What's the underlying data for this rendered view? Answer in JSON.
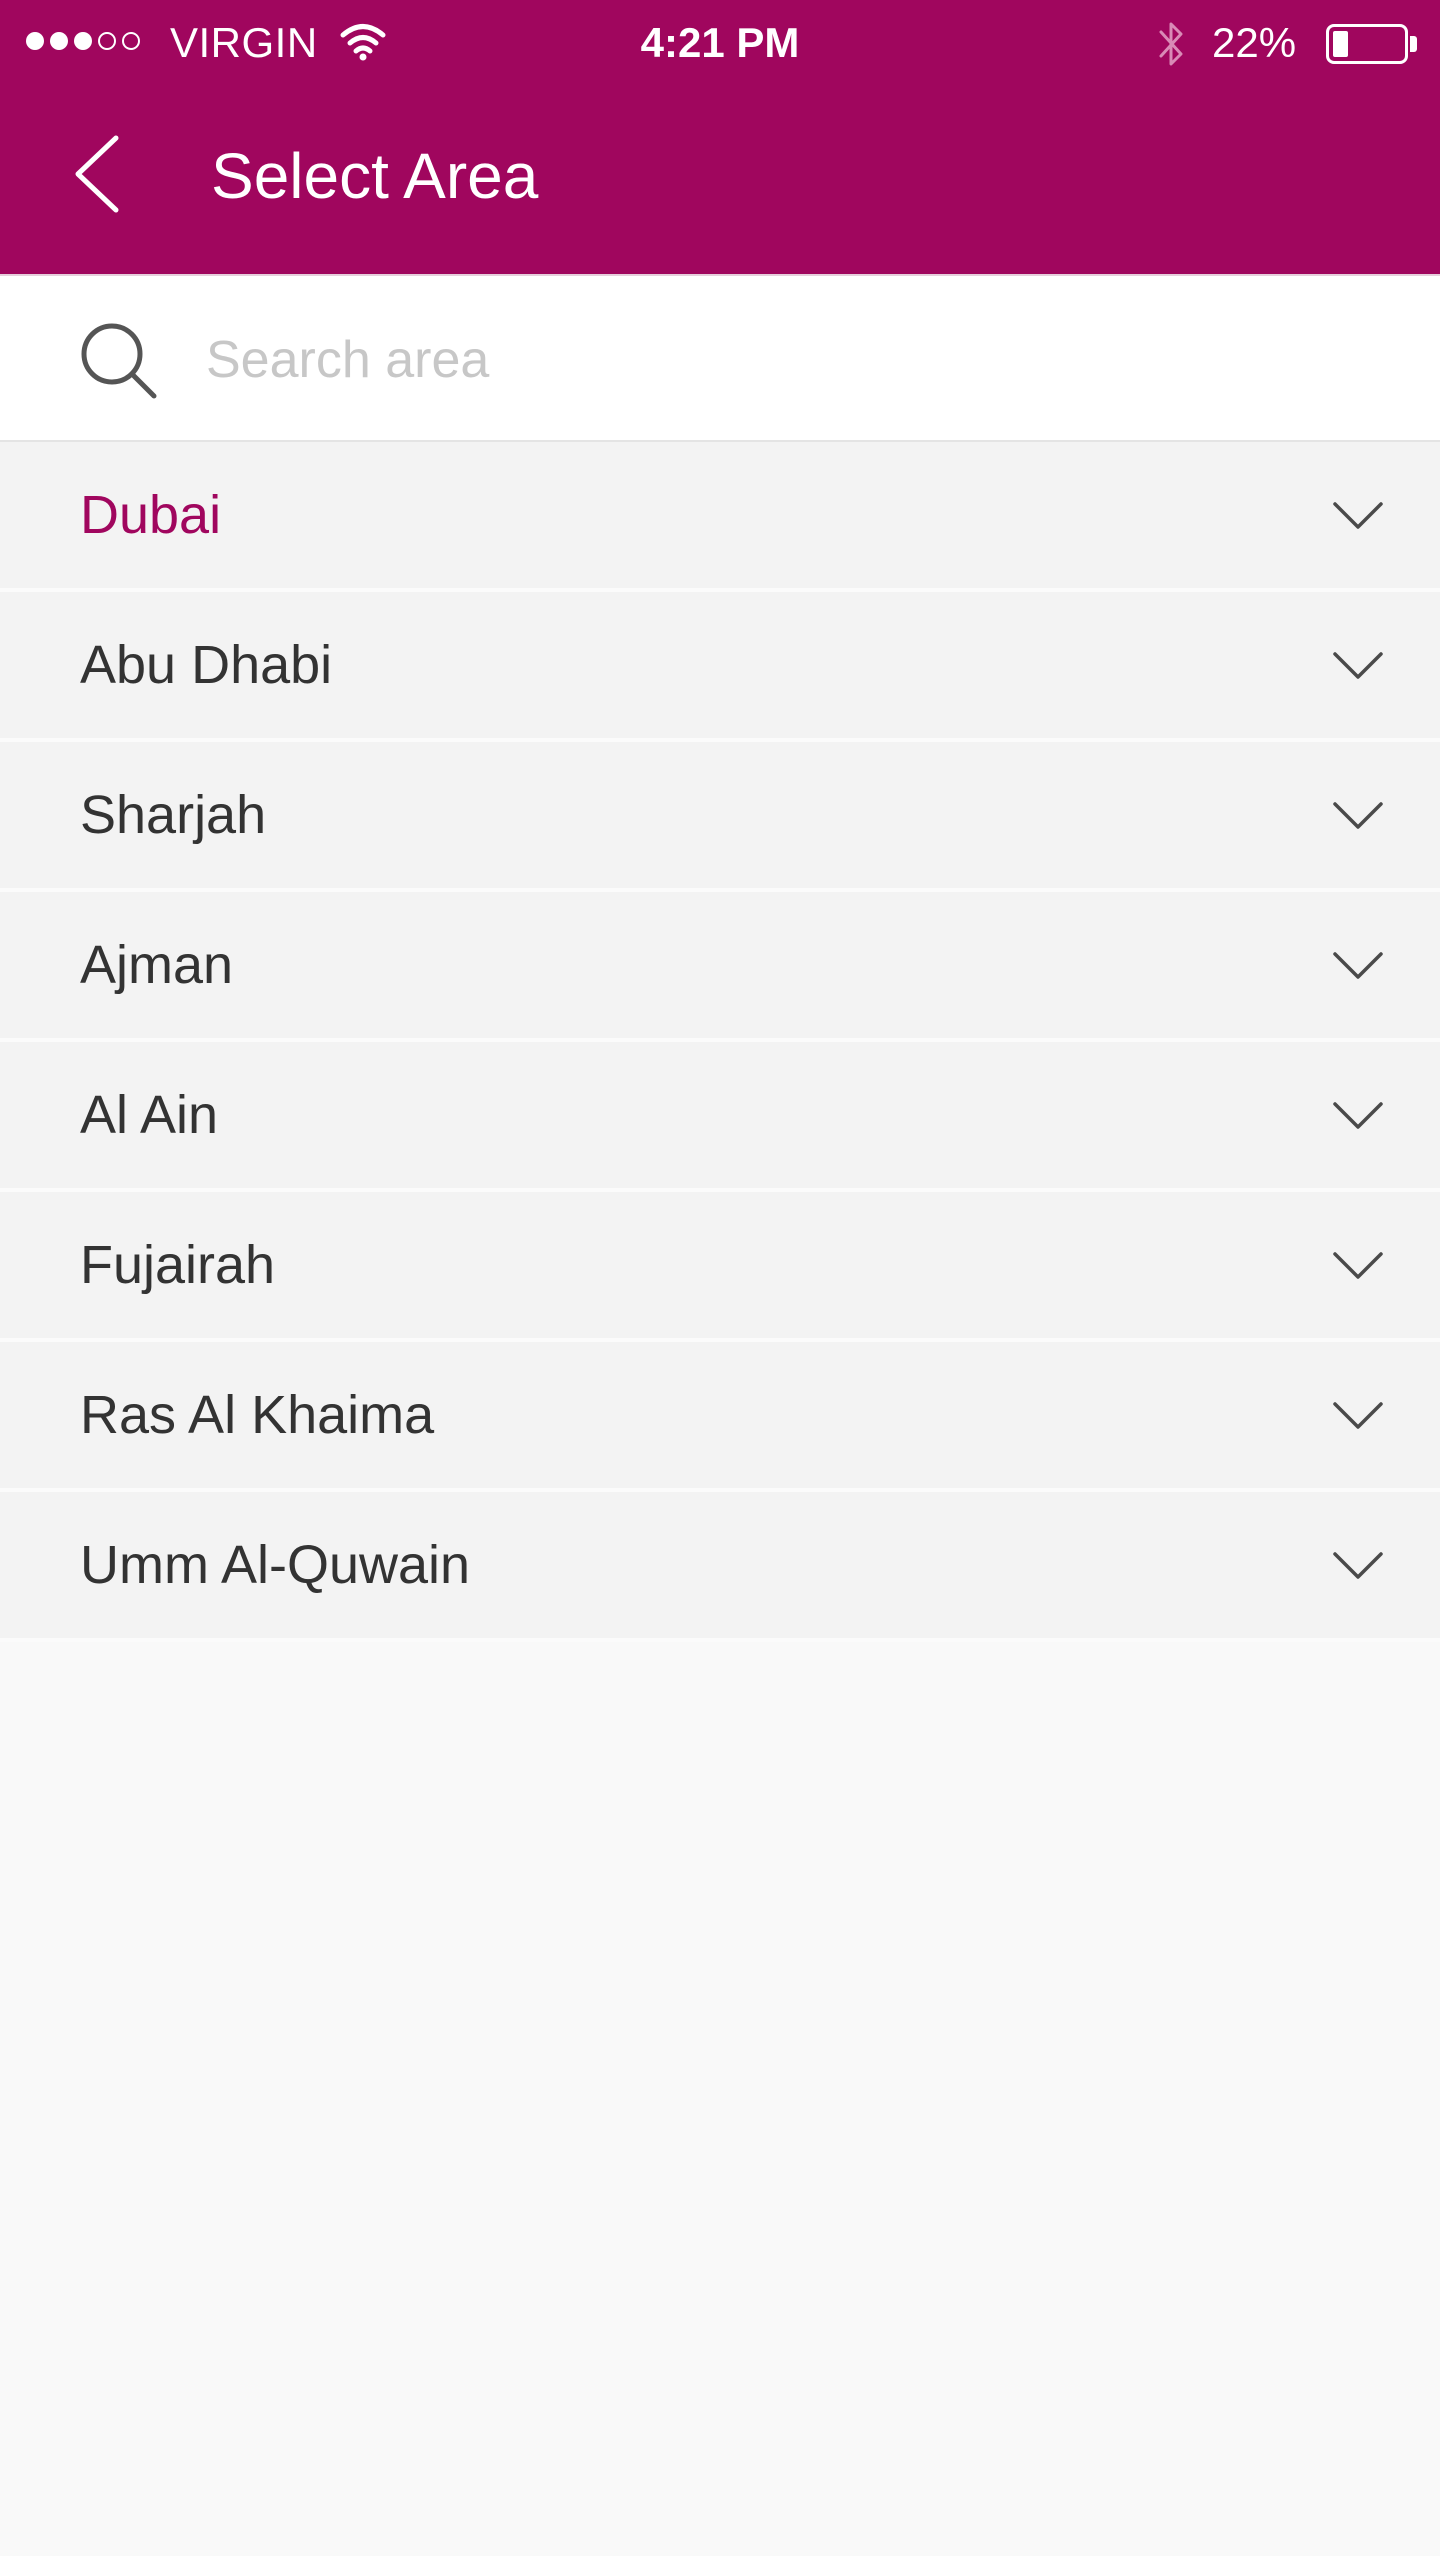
{
  "status_bar": {
    "carrier": "VIRGIN",
    "signal_bars_total": 5,
    "signal_bars_filled": 3,
    "time": "4:21 PM",
    "battery_text": "22%",
    "battery_level": 0.22
  },
  "header": {
    "title": "Select Area",
    "back_icon": "chevron-left-icon"
  },
  "search": {
    "placeholder": "Search area",
    "value": "",
    "icon": "search-icon"
  },
  "areas": [
    {
      "label": "Dubai",
      "selected": true
    },
    {
      "label": "Abu Dhabi",
      "selected": false
    },
    {
      "label": "Sharjah",
      "selected": false
    },
    {
      "label": "Ajman",
      "selected": false
    },
    {
      "label": "Al Ain",
      "selected": false
    },
    {
      "label": "Fujairah",
      "selected": false
    },
    {
      "label": "Ras Al Khaima",
      "selected": false
    },
    {
      "label": "Umm Al-Quwain",
      "selected": false
    }
  ],
  "colors": {
    "brand": "#a0065e",
    "row_background": "#f3f3f3",
    "text": "#333333",
    "placeholder": "#c7c7c7"
  }
}
